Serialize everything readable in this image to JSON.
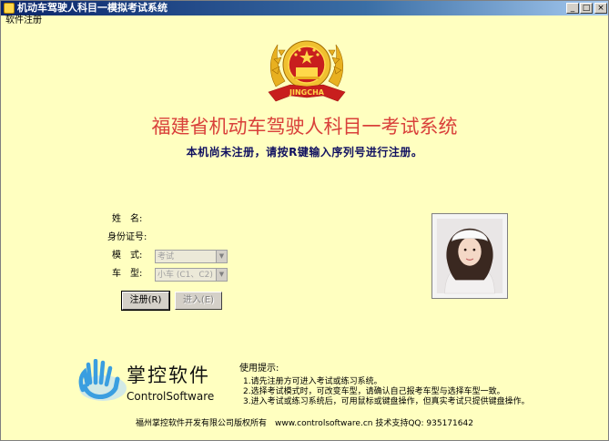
{
  "window": {
    "title": "机动车驾驶人科目一模拟考试系统",
    "minimize_glyph": "_",
    "maximize_glyph": "□",
    "close_glyph": "×"
  },
  "menu": {
    "register": "软件注册"
  },
  "emblem": {
    "ribbon_text": "JINGCHA"
  },
  "heading": "福建省机动车驾驶人科目一考试系统",
  "notice": "本机尚未注册，请按R键输入序列号进行注册。",
  "form": {
    "name_label": "姓　名:",
    "id_label": "身份证号:",
    "mode_label": "模　式:",
    "mode_value": "考试",
    "vehicle_label": "车　型:",
    "vehicle_value": "小车 (C1、C2)"
  },
  "buttons": {
    "register": "注册(R)",
    "enter": "进入(E)"
  },
  "brand": {
    "name_cn": "掌控软件",
    "name_en": "ControlSoftware"
  },
  "tips": {
    "title": "使用提示:",
    "items": [
      "1.请先注册方可进入考试或练习系统。",
      "2.选择考试模式时，可改变车型，请确认自己报考车型与选择车型一致。",
      "3.进入考试或练习系统后，可用鼠标或键盘操作，但真实考试只提供键盘操作。"
    ]
  },
  "footer": "福州掌控软件开发有限公司版权所有　www.controlsoftware.cn 技术支持QQ: 935171642",
  "colors": {
    "background": "#ffffc0",
    "heading": "#d9403a",
    "notice": "#101060",
    "title_bar": "#0a246a"
  },
  "icons": [
    "app-icon",
    "police-emblem-icon",
    "hand-logo-icon"
  ]
}
